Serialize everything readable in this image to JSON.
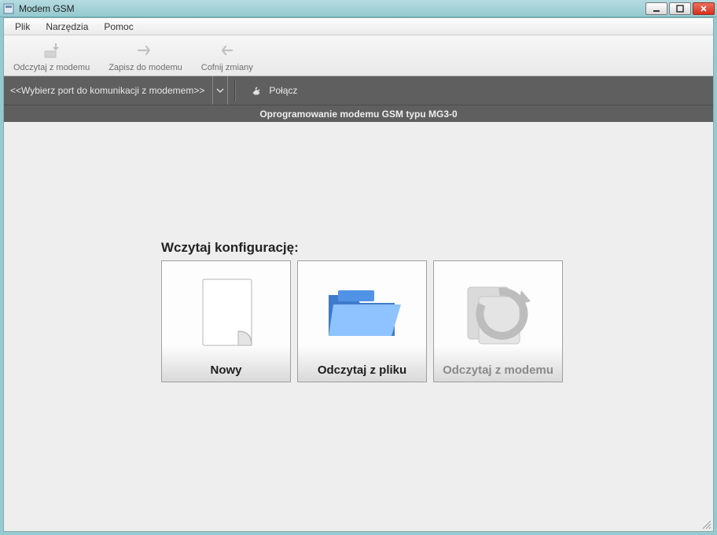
{
  "window": {
    "title": "Modem GSM"
  },
  "menu": {
    "file": "Plik",
    "tools": "Narzędzia",
    "help": "Pomoc"
  },
  "toolbar": {
    "read": "Odczytaj z modemu",
    "write": "Zapisz do modemu",
    "undo": "Cofnij zmiany"
  },
  "comm": {
    "port_placeholder": "<<Wybierz port do komunikacji z modemem>>",
    "connect_label": "Połącz"
  },
  "subtitle": "Oprogramowanie modemu GSM typu MG3-0",
  "load": {
    "heading": "Wczytaj konfigurację:",
    "new_label": "Nowy",
    "from_file_label": "Odczytaj z pliku",
    "from_modem_label": "Odczytaj z modemu"
  }
}
